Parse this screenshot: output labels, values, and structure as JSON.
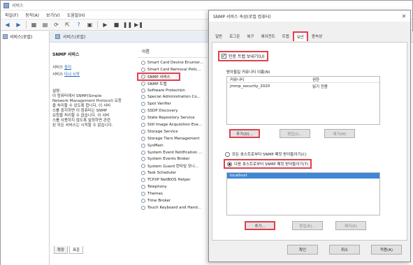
{
  "console": {
    "title": "서비스",
    "menu": [
      "파일(F)",
      "동작(A)",
      "보기(V)",
      "도움말(H)"
    ],
    "tree_root": "서비스(로컬)",
    "pane_header": "서비스(로컬)",
    "selected_service_name": "SNMP 서비스",
    "stop_link_prefix": "서비스 ",
    "stop_link": "중지",
    "restart_link_prefix": "서비스 ",
    "restart_link": "다시 시작",
    "description_label": "설명:",
    "description_text": "이 컴퓨터에서 SNMP(Simple\nNetwork Management Protocol) 요청\n을 처리할 수 있도록 합니다. 이 서비\n스를 중지하면 이 컴퓨터는 SNMP\n요청을 처리할 수 없습니다. 이 서비\n스를 사용하지 않도록 설정하면 관련\n된 모든 서비스는 시작할 수 없습니다.",
    "list_column": "이름",
    "services": [
      "Smart Card Device Enumer...",
      "Smart Card Removal Polic...",
      "SNMP 서비스",
      "SNMP 트랩",
      "Software Protection",
      "Special Administration Co...",
      "Spot Verifier",
      "SSDP Discovery",
      "State Repository Service",
      "Still Image Acquisition Eve...",
      "Storage Service",
      "Storage Tiers Management",
      "SysMain",
      "System Event Notification ...",
      "System Events Broker",
      "System Guard 런타임 모니...",
      "Task Scheduler",
      "TCP/IP NetBIOS Helper",
      "Telephony",
      "Themes",
      "Time Broker",
      "Touch Keyboard and Hand..."
    ],
    "bottom_tabs": [
      "확장",
      "표준"
    ]
  },
  "dialog": {
    "title": "SNMP 서비스 속성(로컬 컴퓨터)",
    "tabs": [
      "일반",
      "로그온",
      "복구",
      "에이전트",
      "트랩",
      "보안",
      "종속성"
    ],
    "active_tab": "보안",
    "send_auth_trap_label": "인증 트랩 보내기(U)",
    "send_auth_trap_checked": true,
    "accepted_communities_label": "받아들일 커뮤니티 이름(N)",
    "community_columns": [
      "커뮤니티",
      "권한"
    ],
    "communities": [
      {
        "name": "jmmp_securtiy_2020",
        "rights": "읽기 전용"
      }
    ],
    "community_buttons": [
      "추가(D)...",
      "편집(I)...",
      "제거(M)"
    ],
    "radio_any_host": "모든 호스트로부터 SNMP 패킷 받아들이기(C)",
    "radio_specific_hosts": "다음 호스트로부터 SNMP 패킷 받아들이기(T)",
    "selected_radio": "specific",
    "hosts": [
      "localhost"
    ],
    "host_buttons": [
      "추가...",
      "편집(E)...",
      "제거(R)"
    ],
    "footer_buttons": [
      "확인",
      "취소",
      "적용(A)"
    ]
  },
  "colors": {
    "highlight": "#e0404f",
    "selection": "#3f86d6",
    "link": "#1a5fb4"
  }
}
